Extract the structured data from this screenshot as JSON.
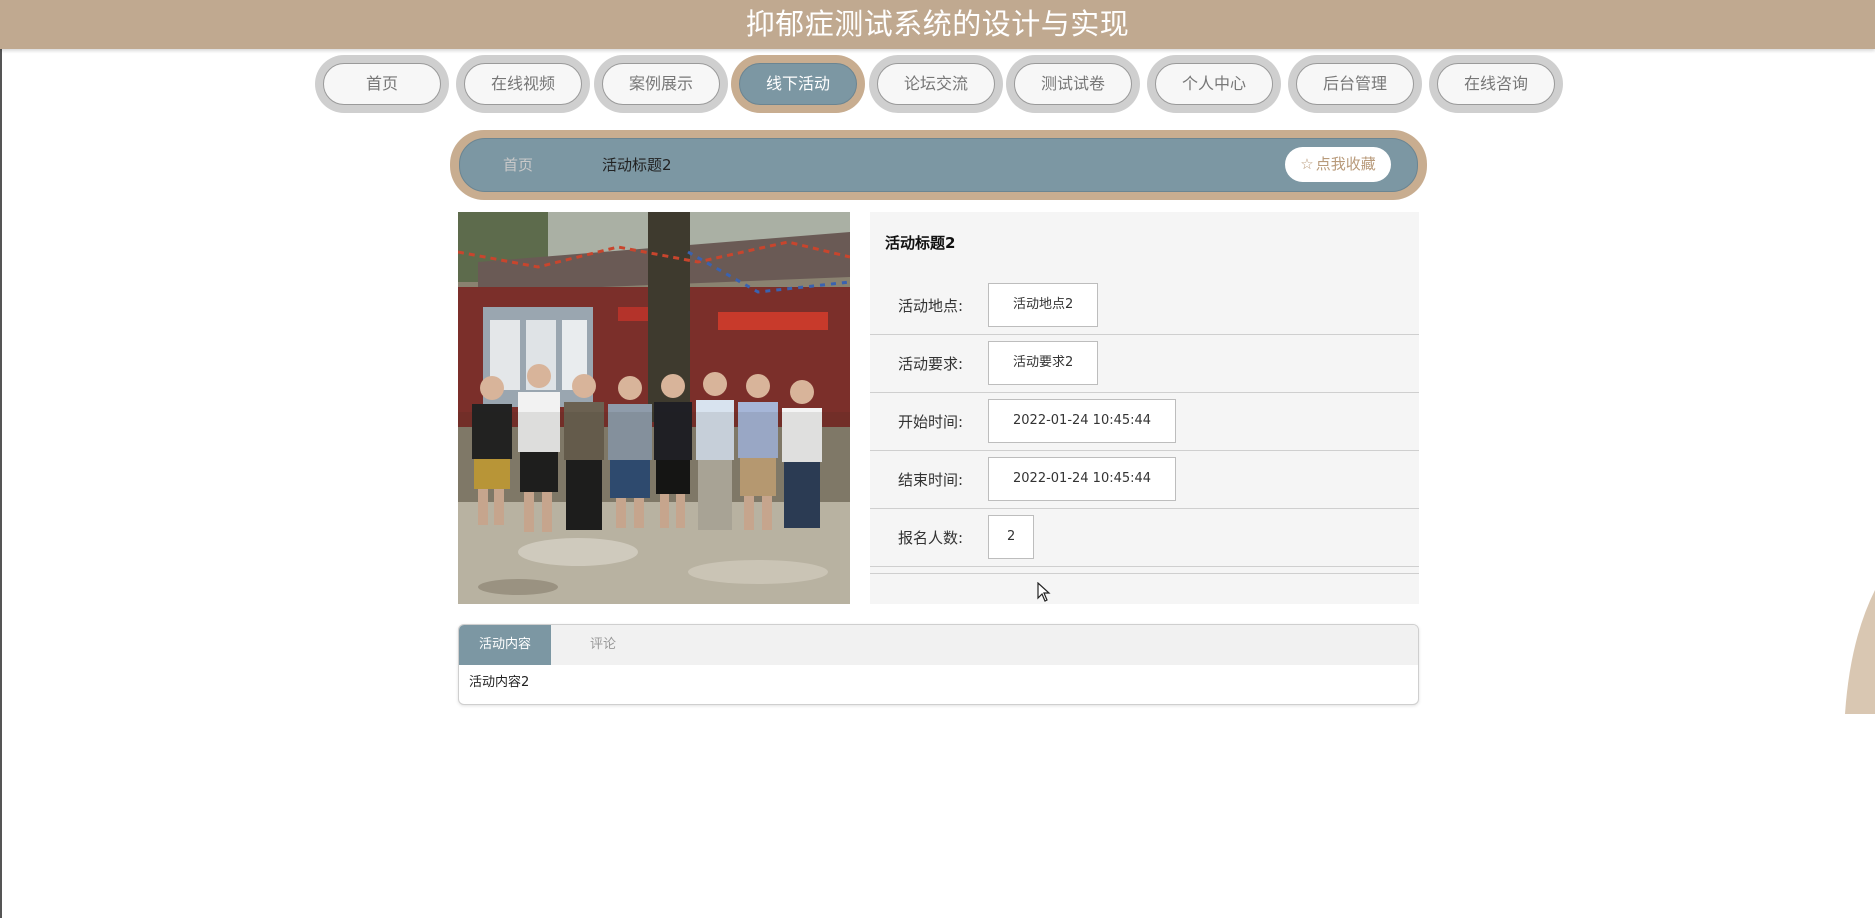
{
  "app": {
    "title": "抑郁症测试系统的设计与实现"
  },
  "nav": {
    "items": [
      {
        "label": "首页",
        "active": false
      },
      {
        "label": "在线视频",
        "active": false
      },
      {
        "label": "案例展示",
        "active": false
      },
      {
        "label": "线下活动",
        "active": true
      },
      {
        "label": "论坛交流",
        "active": false
      },
      {
        "label": "测试试卷",
        "active": false
      },
      {
        "label": "个人中心",
        "active": false
      },
      {
        "label": "后台管理",
        "active": false
      },
      {
        "label": "在线咨询",
        "active": false
      }
    ]
  },
  "breadcrumb": {
    "home": "首页",
    "current": "活动标题2"
  },
  "favorite": {
    "star": "☆",
    "label": "点我收藏"
  },
  "activity": {
    "title": "活动标题2",
    "fields": [
      {
        "label": "活动地点:",
        "value": "活动地点2"
      },
      {
        "label": "活动要求:",
        "value": "活动要求2"
      },
      {
        "label": "开始时间:",
        "value": "2022-01-24 10:45:44"
      },
      {
        "label": "结束时间:",
        "value": "2022-01-24 10:45:44"
      },
      {
        "label": "报名人数:",
        "value": "2"
      }
    ]
  },
  "tabs": {
    "items": [
      {
        "label": "活动内容",
        "active": true
      },
      {
        "label": "评论",
        "active": false
      }
    ],
    "content": "活动内容2"
  },
  "colors": {
    "banner": "#c0a990",
    "accent_blue": "#7c97a3",
    "accent_tan": "#c8ad90"
  }
}
